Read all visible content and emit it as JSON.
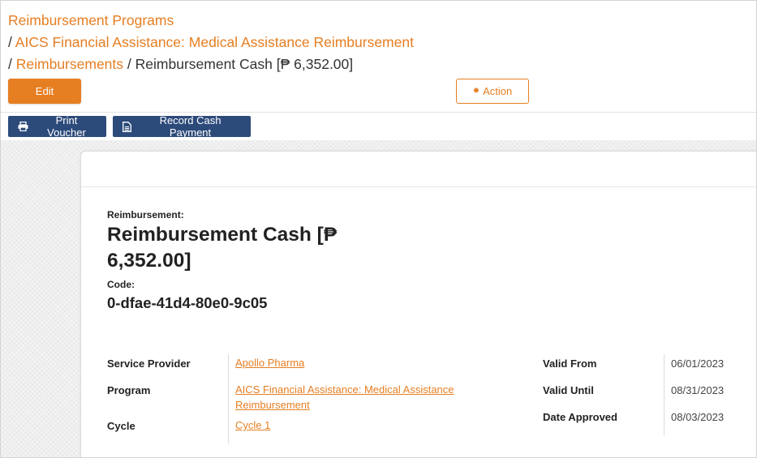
{
  "breadcrumbs": {
    "root": "Reimbursement Programs",
    "program": "AICS Financial Assistance: Medical Assistance Reimbursement",
    "list": "Reimbursements",
    "current": "Reimbursement Cash [₱ 6,352.00]",
    "separator": "/"
  },
  "toolbar": {
    "edit_label": "Edit",
    "action_label": "Action",
    "print_label": "Print Voucher",
    "record_label": "Record Cash Payment"
  },
  "record": {
    "heading_label": "Reimbursement:",
    "title_line1": "Reimbursement Cash [₱",
    "title_line2": "6,352.00]",
    "code_label": "Code:",
    "code_value": "0-dfae-41d4-80e0-9c05"
  },
  "fields": {
    "service_provider_label": "Service Provider",
    "service_provider_value": "Apollo Pharma",
    "program_label": "Program",
    "program_value_line1": "AICS Financial Assistance: Medical Assistance",
    "program_value_line2": "Reimbursement",
    "cycle_label": "Cycle",
    "cycle_value": "Cycle 1",
    "valid_from_label": "Valid From",
    "valid_from_value": "06/01/2023",
    "valid_until_label": "Valid Until",
    "valid_until_value": "08/31/2023",
    "date_approved_label": "Date Approved",
    "date_approved_value": "08/03/2023"
  },
  "colors": {
    "accent": "#e67e22",
    "dark_button": "#2c4a7a"
  },
  "icons": {
    "action": "gear-icon",
    "print": "printer-icon",
    "record": "document-icon"
  }
}
